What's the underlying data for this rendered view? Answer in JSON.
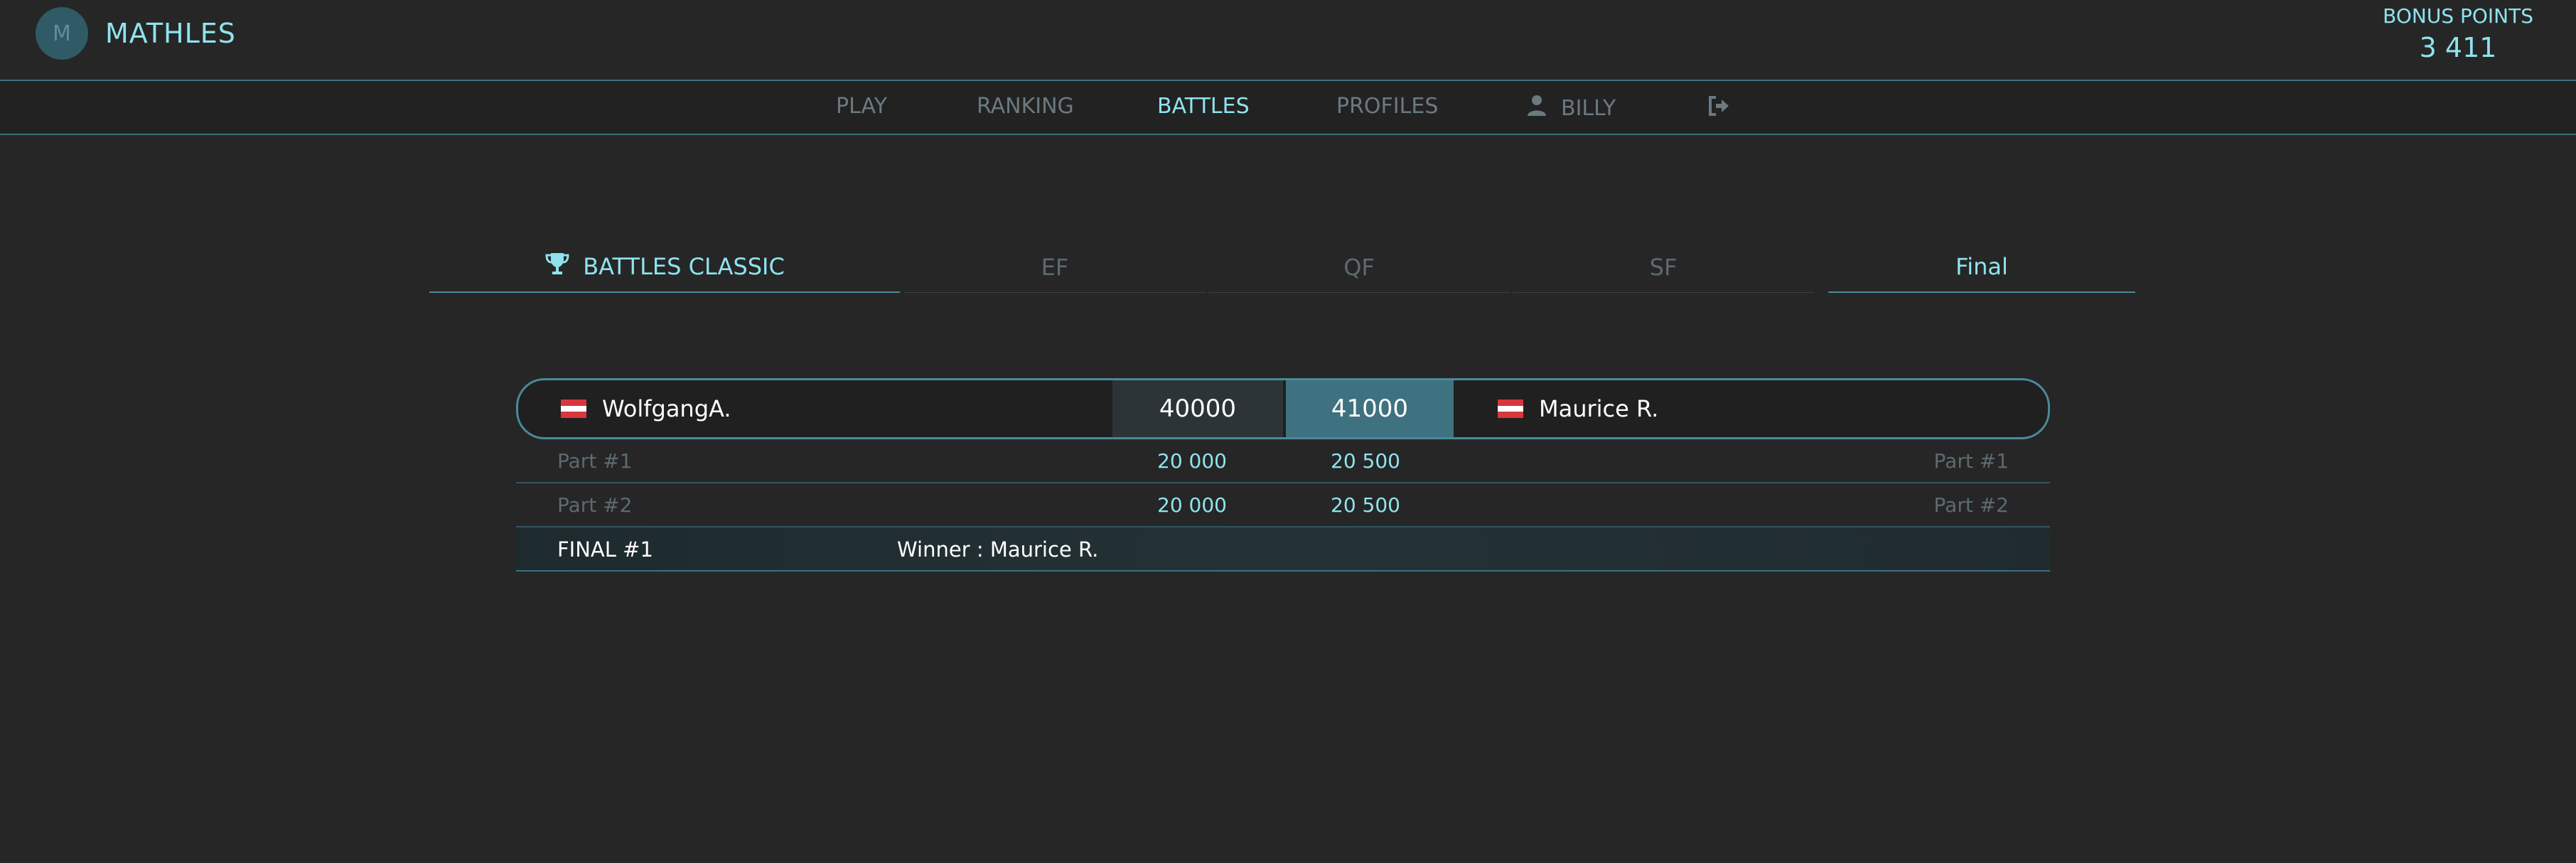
{
  "header": {
    "app_title": "MATHLES",
    "logo_glyph": "M",
    "bonus_label": "BONUS POINTS",
    "bonus_value": "3 411"
  },
  "nav": {
    "items": [
      {
        "label": "PLAY"
      },
      {
        "label": "RANKING"
      },
      {
        "label": "BATTLES"
      },
      {
        "label": "PROFILES"
      },
      {
        "label": "BILLY"
      }
    ],
    "active": "BATTLES",
    "user_icon": "user-icon",
    "logout_icon": "logout-icon"
  },
  "rounds": {
    "tabs": [
      {
        "label": "BATTLES CLASSIC",
        "icon": "trophy-icon"
      },
      {
        "label": "EF"
      },
      {
        "label": "QF"
      },
      {
        "label": "SF"
      },
      {
        "label": "Final"
      }
    ]
  },
  "match": {
    "left_player": "WolfgangA.",
    "right_player": "Maurice R.",
    "left_score": "40000",
    "right_score": "41000",
    "parts": [
      {
        "left_label": "Part #1",
        "left_score": "20 000",
        "right_score": "20 500",
        "right_label": "Part #1"
      },
      {
        "left_label": "Part #2",
        "left_score": "20 000",
        "right_score": "20 500",
        "right_label": "Part #2"
      }
    ],
    "final_label": "FINAL #1",
    "winner_text": "Winner : Maurice R."
  },
  "colors": {
    "background": "#262626",
    "accent": "#8fe3ee",
    "border": "#4a8a99",
    "winner_score_bg": "#3f7281",
    "flag_red": "#d9363e",
    "flag_white": "#ffffff"
  }
}
